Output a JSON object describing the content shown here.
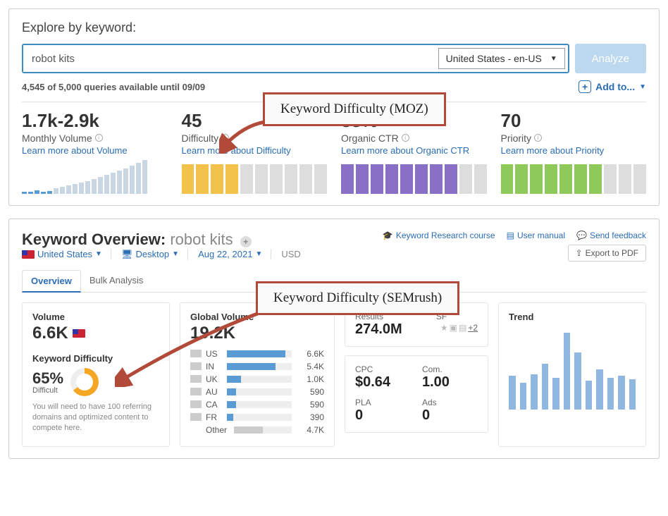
{
  "moz": {
    "title": "Explore by keyword:",
    "keyword": "robot kits",
    "region": "United States - en-US",
    "analyze_label": "Analyze",
    "quota_text": "4,545 of 5,000 queries available until 09/09",
    "add_to_label": "Add to...",
    "stats": {
      "volume": {
        "value": "1.7k-2.9k",
        "label": "Monthly Volume",
        "learn": "Learn more about Volume"
      },
      "difficulty": {
        "value": "45",
        "label": "Difficulty",
        "learn": "Learn more about Difficulty"
      },
      "ctr": {
        "value": "83%",
        "label": "Organic CTR",
        "learn": "Learn more about Organic CTR"
      },
      "priority": {
        "value": "70",
        "label": "Priority",
        "learn": "Learn more about Priority"
      }
    },
    "annotation": "Keyword Difficulty (MOZ)"
  },
  "sem": {
    "title_prefix": "Keyword Overview:",
    "keyword": "robot kits",
    "links": {
      "course": "Keyword Research course",
      "manual": "User manual",
      "feedback": "Send feedback",
      "export": "Export to PDF"
    },
    "filters": {
      "country": "United States",
      "device": "Desktop",
      "date": "Aug 22, 2021",
      "currency": "USD"
    },
    "tabs": {
      "overview": "Overview",
      "bulk": "Bulk Analysis"
    },
    "volume_label": "Volume",
    "volume_value": "6.6K",
    "kd_label": "Keyword Difficulty",
    "kd_value": "65%",
    "kd_level": "Difficult",
    "kd_desc": "You will need to have 100 referring domains and optimized content to compete here.",
    "gv_label": "Global Volume",
    "gv_value": "19.2K",
    "gv_rows": [
      {
        "code": "US",
        "val": "6.6K",
        "pct": 90
      },
      {
        "code": "IN",
        "val": "5.4K",
        "pct": 75
      },
      {
        "code": "UK",
        "val": "1.0K",
        "pct": 22
      },
      {
        "code": "AU",
        "val": "590",
        "pct": 14
      },
      {
        "code": "CA",
        "val": "590",
        "pct": 14
      },
      {
        "code": "FR",
        "val": "390",
        "pct": 10
      }
    ],
    "gv_other_label": "Other",
    "gv_other_val": "4.7K",
    "gv_other_pct": 50,
    "results_label": "Results",
    "results_value": "274.0M",
    "sf_label": "SF",
    "sf_more": "+2",
    "cpc_label": "CPC",
    "cpc_value": "$0.64",
    "com_label": "Com.",
    "com_value": "1.00",
    "pla_label": "PLA",
    "pla_value": "0",
    "ads_label": "Ads",
    "ads_value": "0",
    "trend_label": "Trend",
    "trend_bars": [
      40,
      32,
      42,
      55,
      38,
      92,
      68,
      34,
      48,
      38,
      40,
      36
    ],
    "annotation": "Keyword Difficulty (SEMrush)"
  }
}
